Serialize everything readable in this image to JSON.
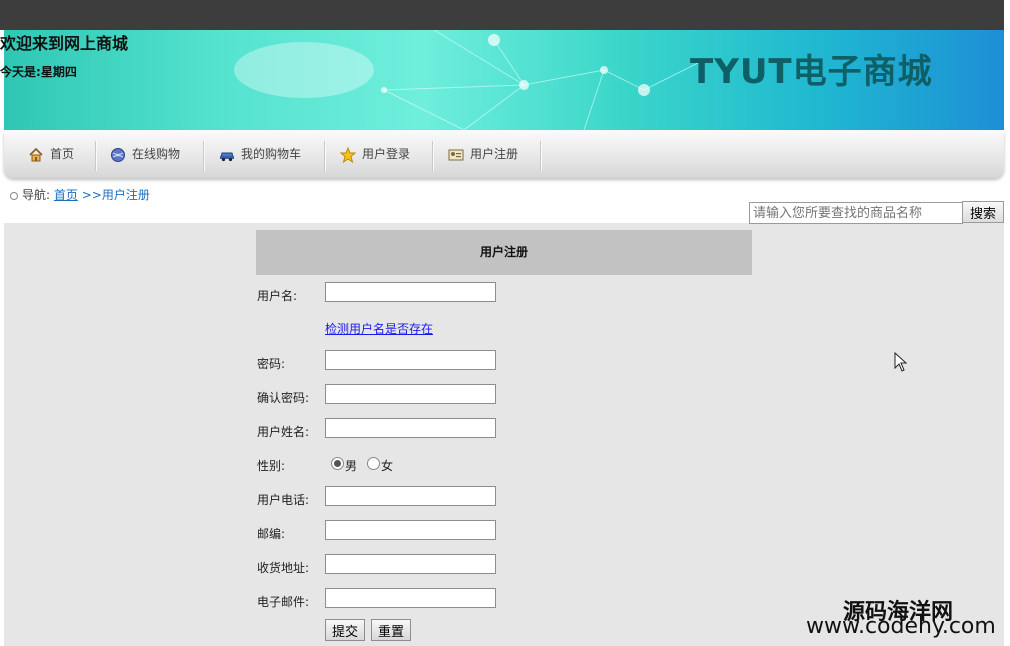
{
  "header": {
    "welcome": "欢迎来到网上商城",
    "today_label": "今天是:",
    "weekday": "星期四",
    "brand": "TYUT电子商城"
  },
  "nav": {
    "items": [
      {
        "label": "首页",
        "icon": "home-icon"
      },
      {
        "label": "在线购物",
        "icon": "globe-icon"
      },
      {
        "label": "我的购物车",
        "icon": "car-icon"
      },
      {
        "label": "用户登录",
        "icon": "star-icon"
      },
      {
        "label": "用户注册",
        "icon": "id-card-icon"
      }
    ]
  },
  "breadcrumb": {
    "prefix": "导航:",
    "home_link": "首页",
    "current": ">>用户注册"
  },
  "search": {
    "placeholder": "请输入您所要查找的商品名称",
    "button": "搜索"
  },
  "form": {
    "title": "用户注册",
    "username_label": "用户名:",
    "check_link": "检测用户名是否存在",
    "password_label": "密码:",
    "confirm_label": "确认密码:",
    "realname_label": "用户姓名:",
    "gender_label": "性别:",
    "gender_options": [
      "男",
      "女"
    ],
    "gender_selected": "男",
    "phone_label": "用户电话:",
    "zip_label": "邮编:",
    "address_label": "收货地址:",
    "email_label": "电子邮件:",
    "submit": "提交",
    "reset": "重置"
  },
  "watermark": {
    "site_name": "源码海洋网",
    "site_url": "www.codehy.com"
  },
  "colors": {
    "topbar": "#3d3d3d",
    "brand_text": "#0f5f66",
    "link": "#1a6fc0",
    "form_title_bg": "#c2c2c2",
    "main_bg": "#e6e6e6"
  }
}
